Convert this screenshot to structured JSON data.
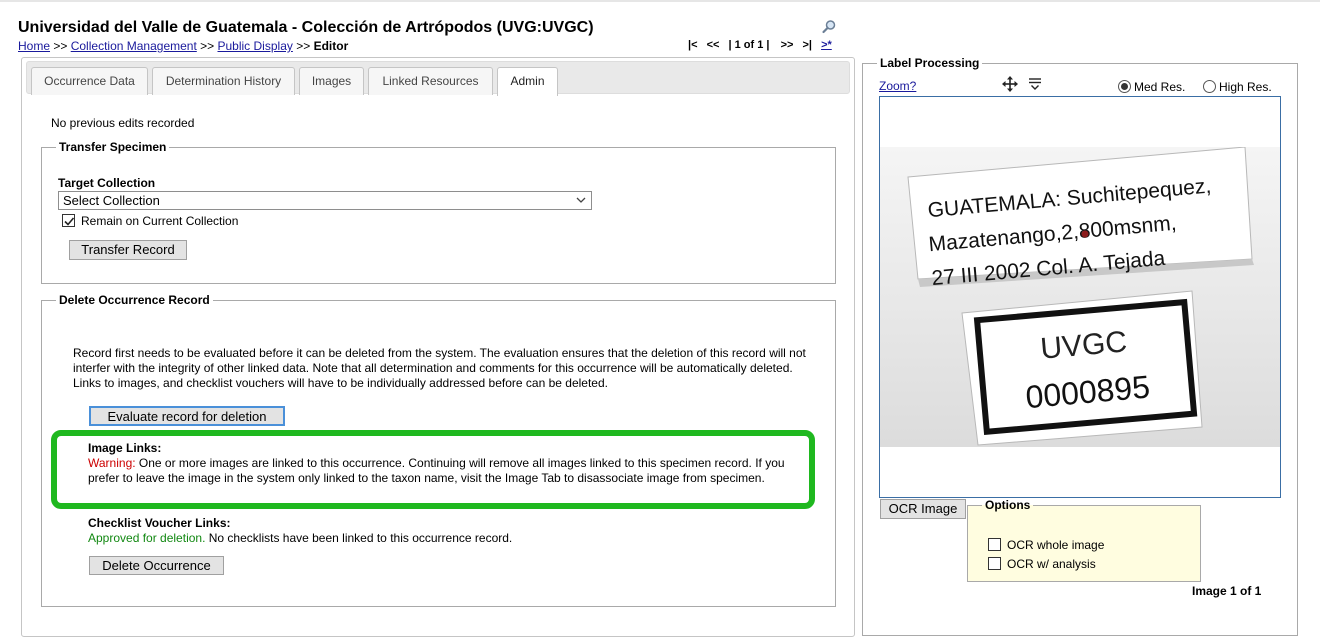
{
  "header": {
    "title": "Universidad del Valle de Guatemala - Colección de Artrópodos (UVG:UVGC)",
    "breadcrumb": {
      "home": "Home",
      "sep": ">>",
      "collection_management": "Collection Management",
      "public_display": "Public Display",
      "current": "Editor"
    },
    "pager": {
      "first": "|<",
      "prev": "<<",
      "count": "| 1 of 1 |",
      "next": ">>",
      "last": ">|",
      "new": ">*"
    }
  },
  "tabs": [
    {
      "label": "Occurrence Data"
    },
    {
      "label": "Determination History"
    },
    {
      "label": "Images"
    },
    {
      "label": "Linked Resources"
    },
    {
      "label": "Admin"
    }
  ],
  "admin": {
    "no_edits": "No previous edits recorded",
    "transfer": {
      "legend": "Transfer Specimen",
      "target_label": "Target Collection",
      "select_value": "Select Collection",
      "remain_label": "Remain on Current Collection",
      "remain_checked": true,
      "button": "Transfer Record"
    },
    "delete": {
      "legend": "Delete Occurrence Record",
      "description": "Record first needs to be evaluated before it can be deleted from the system. The evaluation ensures that the deletion of this record will not interfer with the integrity of other linked data. Note that all determination and comments for this occurrence will be automatically deleted. Links to images, and checklist vouchers will have to be individually addressed before can be deleted.",
      "evaluate_button": "Evaluate record for deletion",
      "image_links_head": "Image Links:",
      "image_links_warning": "Warning:",
      "image_links_text": " One or more images are linked to this occurrence. Continuing will remove all images linked to this specimen record. If you prefer to leave the image in the system only linked to the taxon name, visit the Image Tab to disassociate image from specimen.",
      "checklist_head": "Checklist Voucher Links:",
      "checklist_ok": "Approved for deletion.",
      "checklist_text": " No checklists have been linked to this occurrence record.",
      "delete_button": "Delete Occurrence"
    }
  },
  "label_processing": {
    "legend": "Label Processing",
    "zoom": "Zoom?",
    "med_res": "Med Res.",
    "high_res": "High Res.",
    "selected_res": "med",
    "image_text": {
      "line1": "GUATEMALA: Suchitepequez,",
      "line2": "Mazatenango,2,800msnm,",
      "line3": "27 III 2002 Col. A. Tejada",
      "code1": "UVGC",
      "code2": "0000895"
    },
    "ocr_button": "OCR Image",
    "options_legend": "Options",
    "ocr_whole": "OCR whole image",
    "ocr_analysis": "OCR w/ analysis",
    "image_count": "Image 1 of 1"
  },
  "colors": {
    "highlight": "#1fb81f",
    "warning": "#cc0000",
    "approved": "#118811",
    "link": "#1a1a9c"
  }
}
